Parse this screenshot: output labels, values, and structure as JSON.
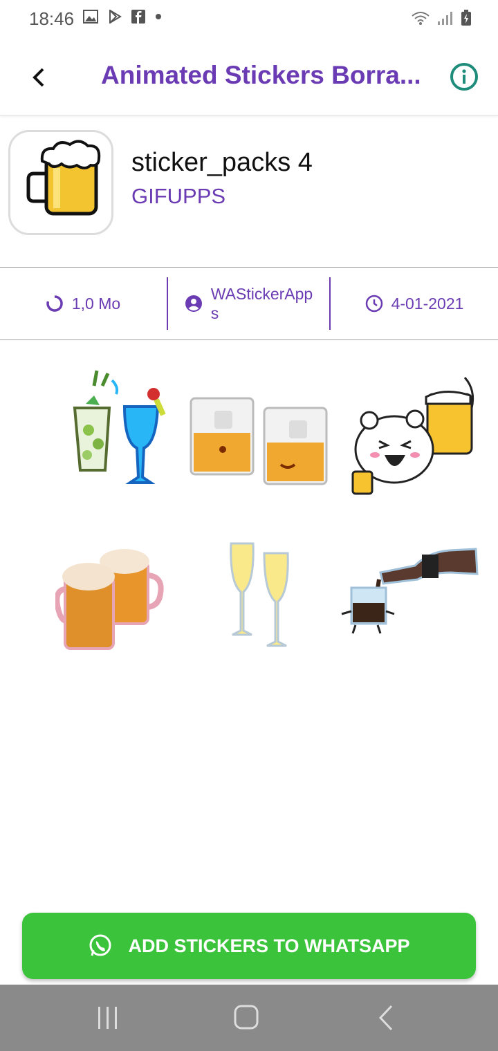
{
  "status_bar": {
    "time": "18:46"
  },
  "app_bar": {
    "title": "Animated Stickers Borra..."
  },
  "pack": {
    "name": "sticker_packs 4",
    "publisher": "GIFUPPS"
  },
  "meta": {
    "size": "1,0 Mo",
    "author_line1": "WAStickerApp",
    "author_line2": "s",
    "date": "4-01-2021"
  },
  "stickers": [
    {
      "name": "cocktails"
    },
    {
      "name": "whisky-glasses"
    },
    {
      "name": "bear-beer"
    },
    {
      "name": "beer-mugs"
    },
    {
      "name": "champagne-glasses"
    },
    {
      "name": "soda-bottle"
    }
  ],
  "add_button": {
    "label": "ADD STICKERS TO WHATSAPP"
  },
  "colors": {
    "accent": "#6a3bb3",
    "button": "#3bc43b",
    "info": "#1e8c7a",
    "nav": "#8a8a8a"
  }
}
